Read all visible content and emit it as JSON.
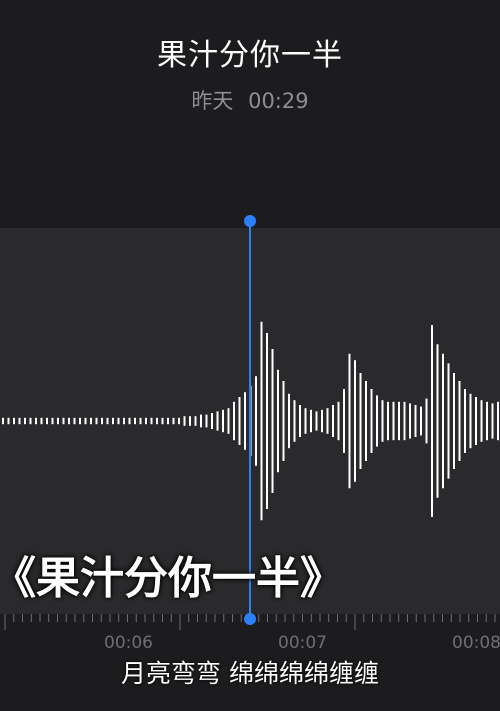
{
  "recording": {
    "title": "果汁分你一半",
    "date": "昨天",
    "duration": "00:29"
  },
  "timeline": {
    "labels": [
      "00:06",
      "00:07",
      "00:08"
    ]
  },
  "overlay": {
    "title": "《果汁分你一半》",
    "subtitle": "月亮弯弯 绵绵绵绵缠缠"
  },
  "waveform": {
    "amplitudes": [
      0.02,
      0.02,
      0.02,
      0.02,
      0.02,
      0.02,
      0.02,
      0.02,
      0.02,
      0.02,
      0.02,
      0.02,
      0.02,
      0.02,
      0.02,
      0.02,
      0.02,
      0.02,
      0.02,
      0.02,
      0.02,
      0.02,
      0.02,
      0.02,
      0.02,
      0.02,
      0.02,
      0.02,
      0.02,
      0.02,
      0.02,
      0.02,
      0.02,
      0.03,
      0.03,
      0.03,
      0.04,
      0.04,
      0.05,
      0.06,
      0.07,
      0.08,
      0.12,
      0.15,
      0.18,
      0.22,
      0.28,
      0.62,
      0.55,
      0.45,
      0.32,
      0.25,
      0.17,
      0.13,
      0.1,
      0.08,
      0.07,
      0.06,
      0.07,
      0.08,
      0.1,
      0.12,
      0.2,
      0.42,
      0.38,
      0.3,
      0.25,
      0.2,
      0.16,
      0.13,
      0.12,
      0.12,
      0.12,
      0.12,
      0.11,
      0.1,
      0.09,
      0.14,
      0.6,
      0.48,
      0.42,
      0.36,
      0.3,
      0.25,
      0.2,
      0.17,
      0.15,
      0.13,
      0.12,
      0.11,
      0.12
    ]
  },
  "colors": {
    "accent": "#2d7ff9",
    "wave": "#ffffff",
    "tick": "#6e6e73"
  }
}
